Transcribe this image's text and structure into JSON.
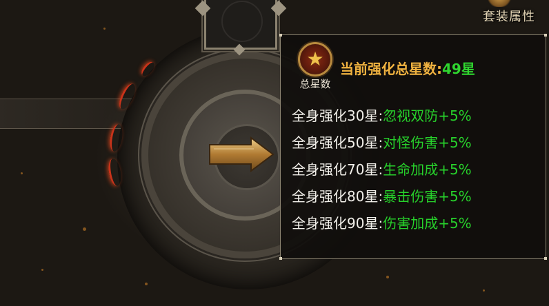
{
  "header": {
    "suit_attribute_label": "套装属性"
  },
  "tooltip": {
    "badge_label": "总星数",
    "total_label": "当前强化总星数:",
    "total_value": "49星",
    "bonuses": [
      {
        "condition": "全身强化30星",
        "effect": "忽视双防+5%"
      },
      {
        "condition": "全身强化50星",
        "effect": "对怪伤害+5%"
      },
      {
        "condition": "全身强化70星",
        "effect": "生命加成+5%"
      },
      {
        "condition": "全身强化80星",
        "effect": "暴击伤害+5%"
      },
      {
        "condition": "全身强化90星",
        "effect": "伤害加成+5%"
      }
    ]
  },
  "colors": {
    "condition_text": "#f2f0ea",
    "effect_text": "#27d12b",
    "total_label": "#f0b240",
    "total_value": "#2fd52f",
    "tooltip_border": "#8d8572"
  },
  "icons": {
    "badge": "star-medal-icon",
    "arrow": "right-arrow-icon"
  }
}
